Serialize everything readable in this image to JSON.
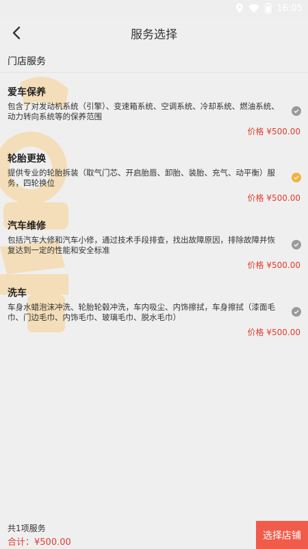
{
  "statusbar": {
    "time": "16:05"
  },
  "header": {
    "title": "服务选择"
  },
  "section": {
    "title": "门店服务"
  },
  "services": [
    {
      "name": "爱车保养",
      "desc": "包含了对发动机系统（引擎）、变速箱系统、空调系统、冷却系统、燃油系统、动力转向系统等的保养范围",
      "price": "价格 ¥500.00",
      "selected": false
    },
    {
      "name": "轮胎更换",
      "desc": "提供专业的轮胎拆装（取气门芯、开启胎唇、卸胎、装胎、充气、动平衡）服务，四轮换位",
      "price": "价格 ¥500.00",
      "selected": true
    },
    {
      "name": "汽车维修",
      "desc": "包括汽车大修和汽车小修，通过技术手段排查，找出故障原因，排除故障并恢复达到一定的性能和安全标准",
      "price": "价格 ¥500.00",
      "selected": false
    },
    {
      "name": "洗车",
      "desc": "车身水蜡泡沫冲洗、轮胎轮毂冲洗，车内吸尘、内饰擦拭，车身擦拭（漆面毛巾、门边毛巾、内饰毛巾、玻璃毛巾、脱水毛巾）",
      "price": "价格 ¥500.00",
      "selected": false
    }
  ],
  "footer": {
    "count": "共1项服务",
    "total": "合计：¥500.00",
    "button": "选择店铺"
  },
  "colors": {
    "accent": "#f15b4a",
    "price": "#e23c2c",
    "check_on": "#f5b13a",
    "check_off": "#9a9a9a"
  }
}
